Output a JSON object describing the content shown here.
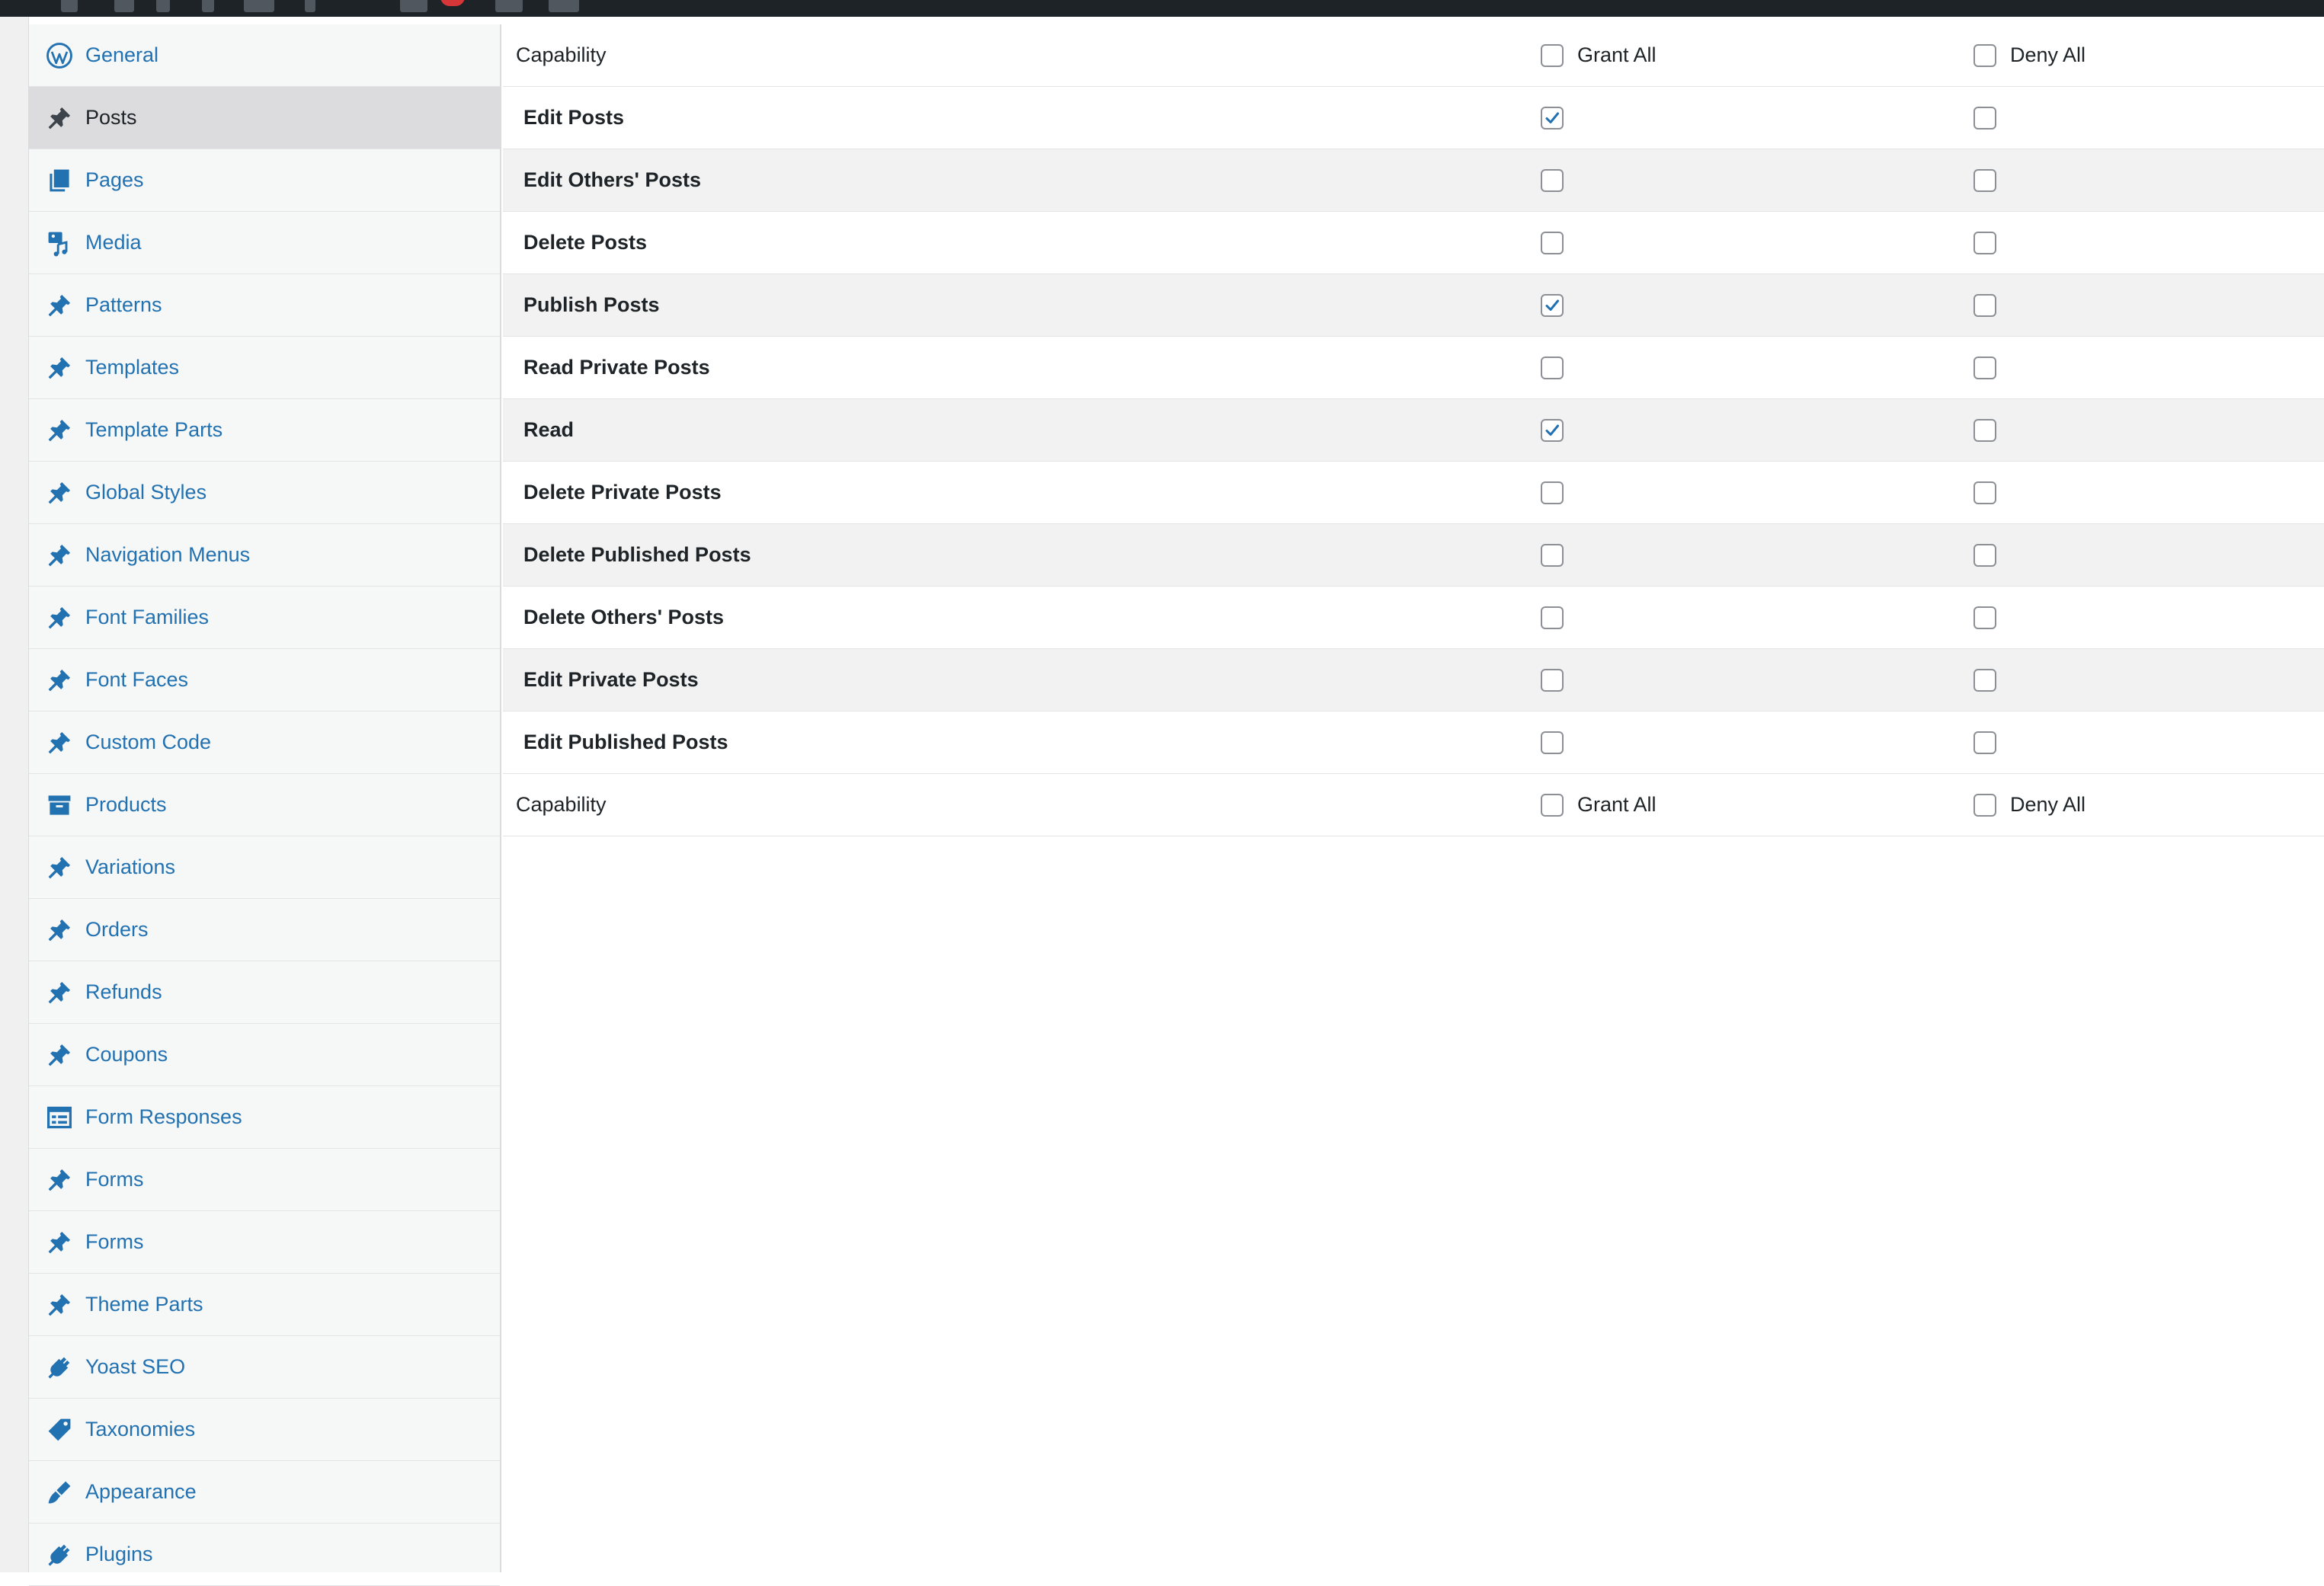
{
  "colors": {
    "admin_bar": "#1d2327",
    "link": "#2271b1",
    "text": "#1d2327",
    "active_row": "#dcdcde",
    "alt_row": "#f2f2f2",
    "badge": "#d63638",
    "icon": "#2271b1"
  },
  "sidebar": {
    "items": [
      {
        "label": "General",
        "icon": "wordpress-icon",
        "active": false
      },
      {
        "label": "Posts",
        "icon": "pin-icon",
        "active": true
      },
      {
        "label": "Pages",
        "icon": "pages-icon",
        "active": false
      },
      {
        "label": "Media",
        "icon": "media-icon",
        "active": false
      },
      {
        "label": "Patterns",
        "icon": "pin-icon",
        "active": false
      },
      {
        "label": "Templates",
        "icon": "pin-icon",
        "active": false
      },
      {
        "label": "Template Parts",
        "icon": "pin-icon",
        "active": false
      },
      {
        "label": "Global Styles",
        "icon": "pin-icon",
        "active": false
      },
      {
        "label": "Navigation Menus",
        "icon": "pin-icon",
        "active": false
      },
      {
        "label": "Font Families",
        "icon": "pin-icon",
        "active": false
      },
      {
        "label": "Font Faces",
        "icon": "pin-icon",
        "active": false
      },
      {
        "label": "Custom Code",
        "icon": "pin-icon",
        "active": false
      },
      {
        "label": "Products",
        "icon": "archive-icon",
        "active": false
      },
      {
        "label": "Variations",
        "icon": "pin-icon",
        "active": false
      },
      {
        "label": "Orders",
        "icon": "pin-icon",
        "active": false
      },
      {
        "label": "Refunds",
        "icon": "pin-icon",
        "active": false
      },
      {
        "label": "Coupons",
        "icon": "pin-icon",
        "active": false
      },
      {
        "label": "Form Responses",
        "icon": "feedback-icon",
        "active": false
      },
      {
        "label": "Forms",
        "icon": "pin-icon",
        "active": false
      },
      {
        "label": "Forms",
        "icon": "pin-icon",
        "active": false
      },
      {
        "label": "Theme Parts",
        "icon": "pin-icon",
        "active": false
      },
      {
        "label": "Yoast SEO",
        "icon": "plugin-icon",
        "active": false
      },
      {
        "label": "Taxonomies",
        "icon": "tag-icon",
        "active": false
      },
      {
        "label": "Appearance",
        "icon": "paintbrush-icon",
        "active": false
      },
      {
        "label": "Plugins",
        "icon": "plugin-icon",
        "active": false
      }
    ]
  },
  "table": {
    "header": {
      "capability": "Capability",
      "grant_all": "Grant All",
      "deny_all": "Deny All"
    },
    "footer": {
      "capability": "Capability",
      "grant_all": "Grant All",
      "deny_all": "Deny All"
    },
    "rows": [
      {
        "name": "Edit Posts",
        "grant": true,
        "deny": false
      },
      {
        "name": "Edit Others' Posts",
        "grant": false,
        "deny": false
      },
      {
        "name": "Delete Posts",
        "grant": false,
        "deny": false
      },
      {
        "name": "Publish Posts",
        "grant": true,
        "deny": false
      },
      {
        "name": "Read Private Posts",
        "grant": false,
        "deny": false
      },
      {
        "name": "Read",
        "grant": true,
        "deny": false
      },
      {
        "name": "Delete Private Posts",
        "grant": false,
        "deny": false
      },
      {
        "name": "Delete Published Posts",
        "grant": false,
        "deny": false
      },
      {
        "name": "Delete Others' Posts",
        "grant": false,
        "deny": false
      },
      {
        "name": "Edit Private Posts",
        "grant": false,
        "deny": false
      },
      {
        "name": "Edit Published Posts",
        "grant": false,
        "deny": false
      }
    ]
  }
}
